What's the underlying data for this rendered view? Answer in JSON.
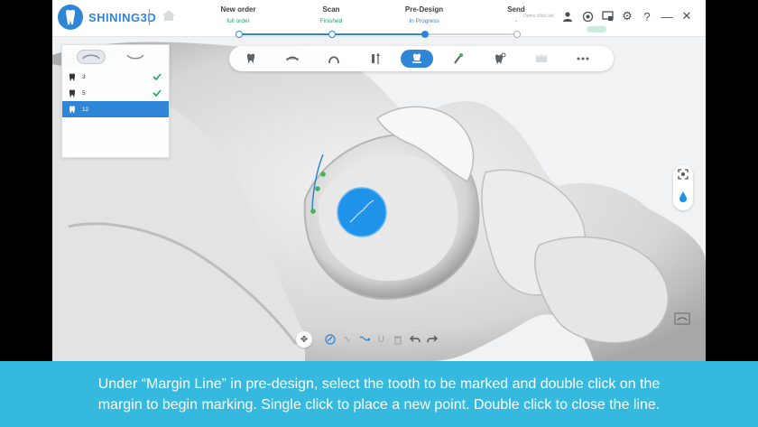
{
  "app": {
    "brand": "SHINING3D",
    "account_text": "Demo.clinic.lab"
  },
  "steps": [
    {
      "title": "New order",
      "status": "full order"
    },
    {
      "title": "Scan",
      "status": "Finished"
    },
    {
      "title": "Pre-Design",
      "status": "In Progress"
    },
    {
      "title": "Send",
      "status": "-"
    }
  ],
  "titlebar_icons": [
    "user-icon",
    "target-settings-icon",
    "screen-record-icon",
    "gear-icon",
    "help-icon",
    "minimize-icon",
    "close-icon"
  ],
  "toolbar_icons": [
    "tooth-icon",
    "occlusal-plane-icon",
    "arch-icon",
    "tooth-axis-icon",
    "margin-line-icon",
    "brush-icon",
    "tooth-eye-icon",
    "model-base-icon",
    "more-icon"
  ],
  "toolbar_active": "margin-line-icon",
  "teeth_panel": {
    "items": [
      {
        "number": "3",
        "done": true
      },
      {
        "number": "5",
        "done": true
      },
      {
        "number": "12",
        "done": false,
        "selected": true
      }
    ]
  },
  "bottom_tools": [
    "move-icon",
    "margin-line-draw-icon",
    "smooth-curve-icon",
    "edit-curve-icon",
    "undercut-icon",
    "delete-icon",
    "undo-icon",
    "redo-icon"
  ],
  "caption": {
    "line1": "Under “Margin Line” in pre-design, select the tooth to be marked and double click on the",
    "line2": "margin to begin marking. Single click to place a new point. Double click to close the line."
  },
  "colors": {
    "accent": "#2f86d6",
    "success": "#1aa35a",
    "caption_bg": "#35b9de"
  }
}
